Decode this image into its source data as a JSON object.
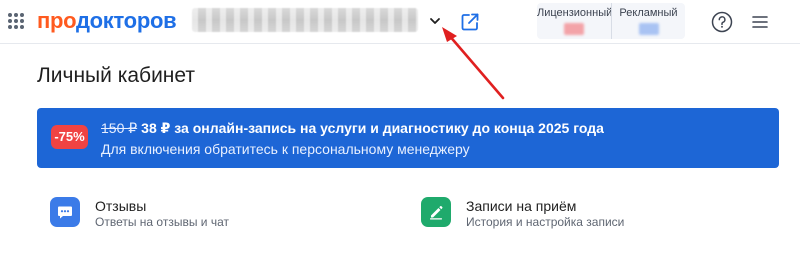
{
  "header": {
    "logo_part1": "про",
    "logo_part2": "докторов",
    "tariffs": [
      {
        "label": "Лицензионный"
      },
      {
        "label": "Рекламный"
      }
    ]
  },
  "main": {
    "title": "Личный кабинет",
    "promo": {
      "badge": "-75%",
      "old_price": "150 ₽",
      "headline": "38 ₽ за онлайн-запись на услуги и диагностику до конца 2025 года",
      "subtext": "Для включения обратитесь к персональному менеджеру"
    },
    "cards": [
      {
        "title": "Отзывы",
        "subtitle": "Ответы на отзывы и чат",
        "icon": "chat-bubble-icon"
      },
      {
        "title": "Записи на приём",
        "subtitle": "История и настройка записи",
        "icon": "pencil-edit-icon"
      }
    ]
  },
  "colors": {
    "brand_orange": "#ff5a1f",
    "brand_blue": "#1e6fe6",
    "promo_bg": "#1d66d6",
    "badge_red": "#f04343",
    "reviews_icon_bg": "#3b7be8",
    "appointments_icon_bg": "#1faa6c",
    "annotation_arrow": "#e02020"
  }
}
